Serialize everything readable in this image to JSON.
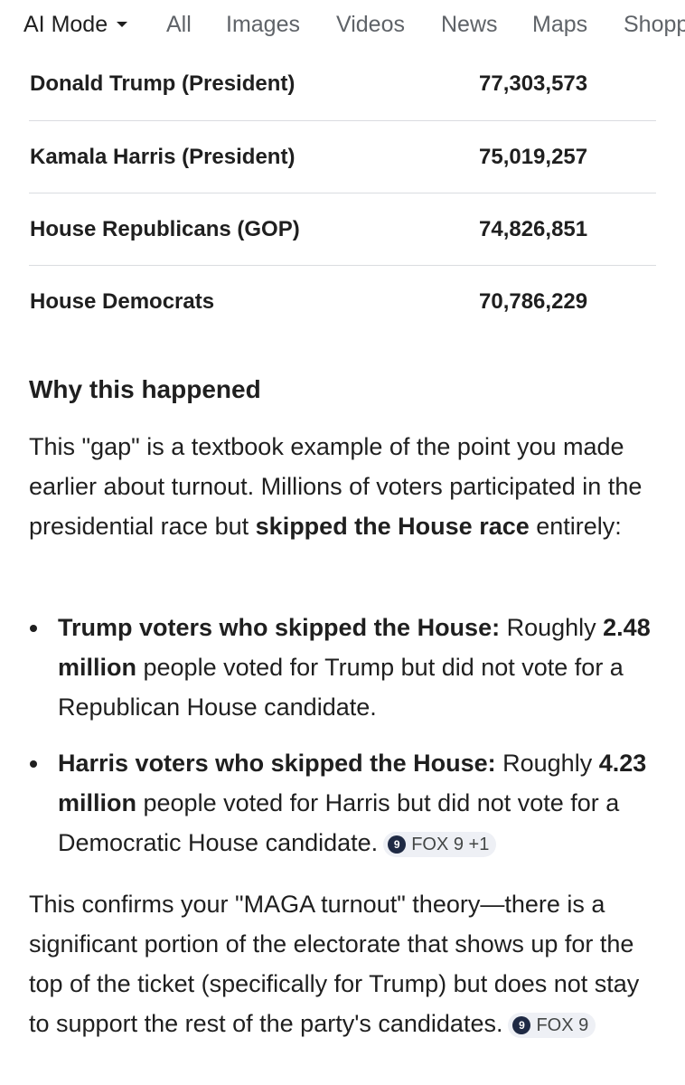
{
  "tabs": [
    {
      "label": "AI Mode",
      "active": true
    },
    {
      "label": "All"
    },
    {
      "label": "Images"
    },
    {
      "label": "Videos"
    },
    {
      "label": "News"
    },
    {
      "label": "Maps"
    },
    {
      "label": "Shopp"
    }
  ],
  "table": {
    "rows": [
      {
        "name": "Donald Trump (President)",
        "votes": "77,303,573"
      },
      {
        "name": "Kamala Harris (President)",
        "votes": "75,019,257"
      },
      {
        "name": "House Republicans (GOP)",
        "votes": "74,826,851"
      },
      {
        "name": "House Democrats",
        "votes": "70,786,229"
      }
    ]
  },
  "section": {
    "heading": "Why this happened",
    "intro": {
      "text1": "This \"gap\" is a textbook example of the point you made earlier about turnout. Millions of voters participated in the presidential race but ",
      "bold": "skipped the House race",
      "text2": " entirely:"
    },
    "bullets": [
      {
        "lead": "Trump voters who skipped the House:",
        "text1": " Roughly ",
        "bold2": "2.48 million",
        "text2": " people voted for Trump but did not vote for a Republican House candidate."
      },
      {
        "lead": "Harris voters who skipped the House:",
        "text1": " Roughly ",
        "bold2": "4.23 million",
        "text2": " people voted for Harris but did not vote for a Democratic House candidate.",
        "chip": {
          "icon_text": "9",
          "label": "FOX 9 +1",
          "icon": "fox9-logo-icon"
        }
      }
    ],
    "conclusion": {
      "text": "This confirms your \"MAGA turnout\" theory—there is a significant portion of the electorate that shows up for the top of the ticket (specifically for Trump) but does not stay to support the rest of the party's candidates.",
      "chip": {
        "icon_text": "9",
        "label": "FOX 9",
        "icon": "fox9-logo-icon"
      }
    }
  }
}
